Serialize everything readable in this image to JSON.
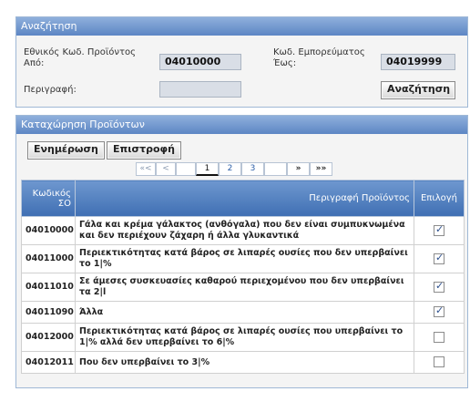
{
  "search": {
    "title": "Αναζήτηση",
    "code_from_label_line1": "Εθνικός Κωδ. Προϊόντος",
    "code_from_label_line2": "Από:",
    "code_from_value": "04010000",
    "code_to_label_line1": "Κωδ. Εμπορεύματος",
    "code_to_label_line2": "Έως:",
    "code_to_value": "04019999",
    "description_label": "Περιγραφή:",
    "description_value": "",
    "search_button": "Αναζήτηση"
  },
  "entry": {
    "title": "Καταχώρηση Προϊόντων",
    "update_button": "Ενημέρωση",
    "back_button": "Επιστροφή",
    "pager": {
      "first": "«<",
      "prev": "<",
      "pages": [
        "1",
        "2",
        "3"
      ],
      "next": "»",
      "last": "»»"
    },
    "columns": {
      "code_line1": "Κωδικός",
      "code_line2": "ΣΟ",
      "description": "Περιγραφή Προϊόντος",
      "selection": "Επιλογή"
    },
    "rows": [
      {
        "code": "04010000",
        "description": "Γάλα και κρέμα γάλακτος (ανθόγαλα) που δεν είναι συμπυκνωμένα και δεν περιέχουν ζάχαρη ή άλλα γλυκαντικά",
        "checked": true
      },
      {
        "code": "04011000",
        "description": "Περιεκτικότητας κατά βάρος σε λιπαρές ουσίες που δεν υπερβαίνει το 1|%",
        "checked": true
      },
      {
        "code": "04011010",
        "description": "Σε άμεσες συσκευασίες καθαρού περιεχομένου που δεν υπερβαίνει τα 2|l",
        "checked": true
      },
      {
        "code": "04011090",
        "description": "Άλλα",
        "checked": true
      },
      {
        "code": "04012000",
        "description": "Περιεκτικότητας κατά βάρος σε λιπαρές ουσίες που υπερβαίνει το 1|% αλλά δεν υπερβαίνει το 6|%",
        "checked": false
      },
      {
        "code": "04012011",
        "description": "Που δεν υπερβαίνει το 3|%",
        "checked": false
      }
    ]
  },
  "colors": {
    "header_gradient_top": "#8fb0dc",
    "header_gradient_bottom": "#5f88c5",
    "panel_border": "#9fb8d6",
    "table_header": "#3f6fb3"
  }
}
